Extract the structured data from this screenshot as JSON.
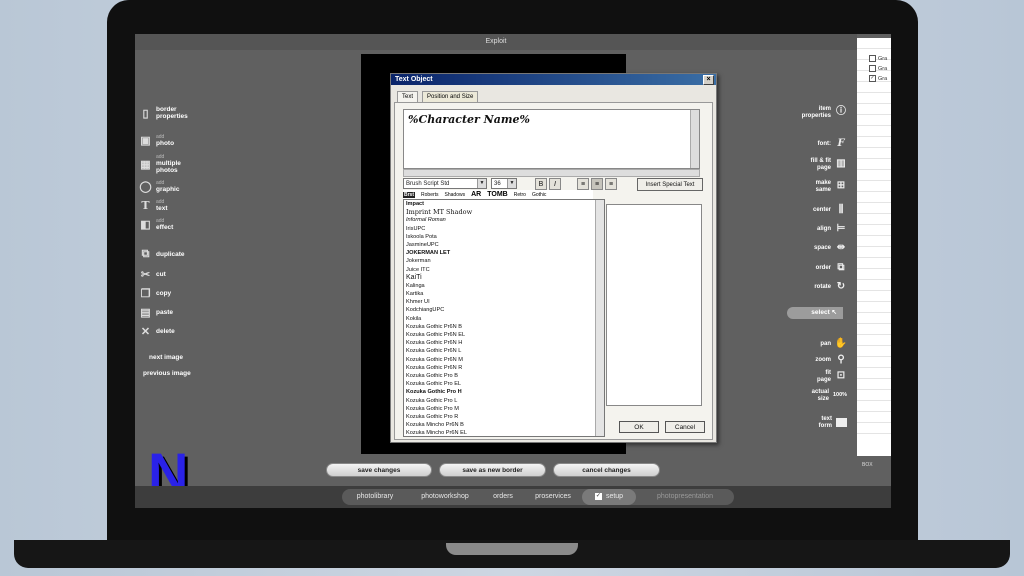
{
  "window": {
    "title": "Exploit"
  },
  "left_nav": {
    "items": [
      {
        "label": "border properties",
        "prefix": "",
        "icon": "page-icon"
      },
      {
        "label": "photo",
        "prefix": "add",
        "icon": "photo-icon"
      },
      {
        "label": "multiple photos",
        "prefix": "add",
        "icon": "multiple-photos-icon"
      },
      {
        "label": "graphic",
        "prefix": "add",
        "icon": "graphic-icon"
      },
      {
        "label": "text",
        "prefix": "add",
        "icon": "text-icon"
      },
      {
        "label": "effect",
        "prefix": "add",
        "icon": "effect-icon"
      },
      {
        "label": "duplicate",
        "prefix": "",
        "icon": "duplicate-icon"
      },
      {
        "label": "cut",
        "prefix": "",
        "icon": "scissors-icon"
      },
      {
        "label": "copy",
        "prefix": "",
        "icon": "copy-icon"
      },
      {
        "label": "paste",
        "prefix": "",
        "icon": "paste-icon"
      },
      {
        "label": "delete",
        "prefix": "",
        "icon": "delete-icon"
      }
    ],
    "next_image": "next image",
    "previous_image": "previous image"
  },
  "right_panel": {
    "item_properties": "item properties",
    "font": "font:",
    "fill_fit": "fill & fit page",
    "make_same": "make same",
    "center": "center",
    "align": "align",
    "space": "space",
    "order": "order",
    "rotate": "rotate",
    "select": "select",
    "pan": "pan",
    "zoom": "zoom",
    "fit_page": "fit page",
    "actual_size": "actual size",
    "actual_size_value": "100%",
    "text_form": "text form"
  },
  "far_right": {
    "checks": [
      "Gra",
      "Gra",
      "Gra"
    ],
    "checked": [
      false,
      false,
      true
    ],
    "box_label": "BOX"
  },
  "dialog": {
    "title": "Text Object",
    "close": "×",
    "tabs": [
      "Text",
      "Position and Size"
    ],
    "text_value": "%Character Name%",
    "font_select": "Brush Script Std",
    "size_select": "36",
    "bold": "B",
    "italic": "I",
    "insert_special": "Insert Special Text",
    "ok": "OK",
    "cancel": "Cancel",
    "preview_items": [
      "Brst",
      "Roberts",
      "Shadows",
      "AR",
      "TOMB",
      "Retro",
      "Gothic"
    ],
    "font_list": [
      "Impact",
      "Imprint MT Shadow",
      "Informal Roman",
      "IrisUPC",
      "Iskoola Pota",
      "JasmineUPC",
      "JOKERMAN LET",
      "Jokerman",
      "Juice ITC",
      "KaiTi",
      "Kalinga",
      "Kartika",
      "Khmer UI",
      "KodchiangUPC",
      "Kokila",
      "Kozuka Gothic Pr6N B",
      "Kozuka Gothic Pr6N EL",
      "Kozuka Gothic Pr6N H",
      "Kozuka Gothic Pr6N L",
      "Kozuka Gothic Pr6N M",
      "Kozuka Gothic Pr6N R",
      "Kozuka Gothic Pro B",
      "Kozuka Gothic Pro EL",
      "Kozuka Gothic Pro H",
      "Kozuka Gothic Pro L",
      "Kozuka Gothic Pro M",
      "Kozuka Gothic Pro R",
      "Kozuka Mincho Pr6N B",
      "Kozuka Mincho Pr6N EL"
    ]
  },
  "bottom_buttons": {
    "save_changes": "save changes",
    "save_as_new_border": "save as new border",
    "cancel_changes": "cancel changes"
  },
  "tabs": {
    "photolibrary": "photolibrary",
    "photoworkshop": "photoworkshop",
    "orders": "orders",
    "proservices": "proservices",
    "setup": "setup",
    "photopresentation": "photopresentation"
  },
  "logo": {
    "letter": "N",
    "color": "#2a22e8"
  }
}
